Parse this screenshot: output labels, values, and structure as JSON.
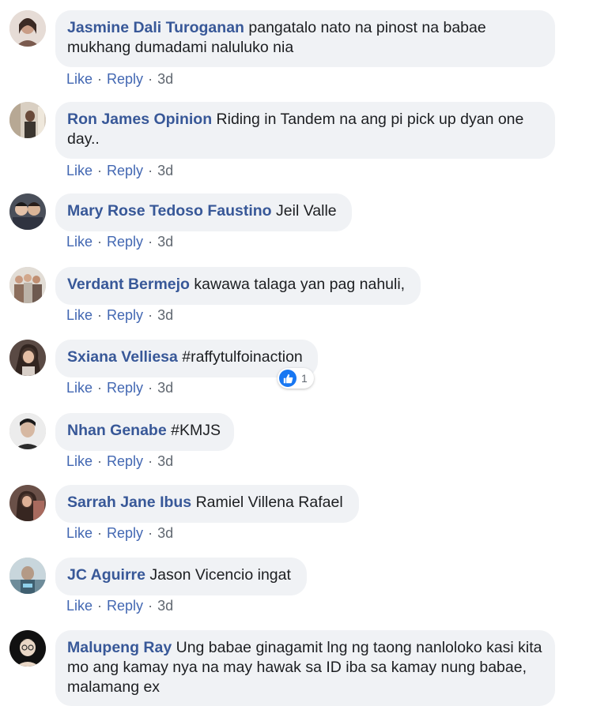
{
  "actions": {
    "like": "Like",
    "reply": "Reply",
    "sep": "·"
  },
  "colors": {
    "link": "#385898",
    "bubble": "#f0f2f5",
    "meta": "#606770",
    "reaction": "#1877f2"
  },
  "comments": [
    {
      "author": "Jasmine Dali Turoganan",
      "text": "pangatalo nato na pinost na babae mukhang dumadami naluluko nia",
      "time": "3d"
    },
    {
      "author": "Ron James Opinion",
      "text": "Riding in Tandem na ang pi pick up dyan one day..",
      "time": "3d"
    },
    {
      "author": "Mary Rose Tedoso Faustino",
      "text": "Jeil Valle",
      "time": "3d"
    },
    {
      "author": "Verdant Bermejo",
      "text": "kawawa talaga yan pag nahuli,",
      "time": "3d"
    },
    {
      "author": "Sxiana Velliesa",
      "text": "#raffytulfoinaction",
      "time": "3d",
      "reaction_icon": "like-icon",
      "reaction_count": "1"
    },
    {
      "author": "Nhan Genabe",
      "text": "#KMJS",
      "time": "3d"
    },
    {
      "author": "Sarrah Jane Ibus",
      "text": "Ramiel Villena Rafael",
      "time": "3d"
    },
    {
      "author": "JC Aguirre",
      "text": "Jason Vicencio ingat",
      "time": "3d"
    },
    {
      "author": "Malupeng Ray",
      "text": "Ung babae ginagamit lng ng taong nanloloko kasi kita mo ang kamay nya na may hawak sa ID iba sa kamay nung babae, malamang ex"
    }
  ]
}
